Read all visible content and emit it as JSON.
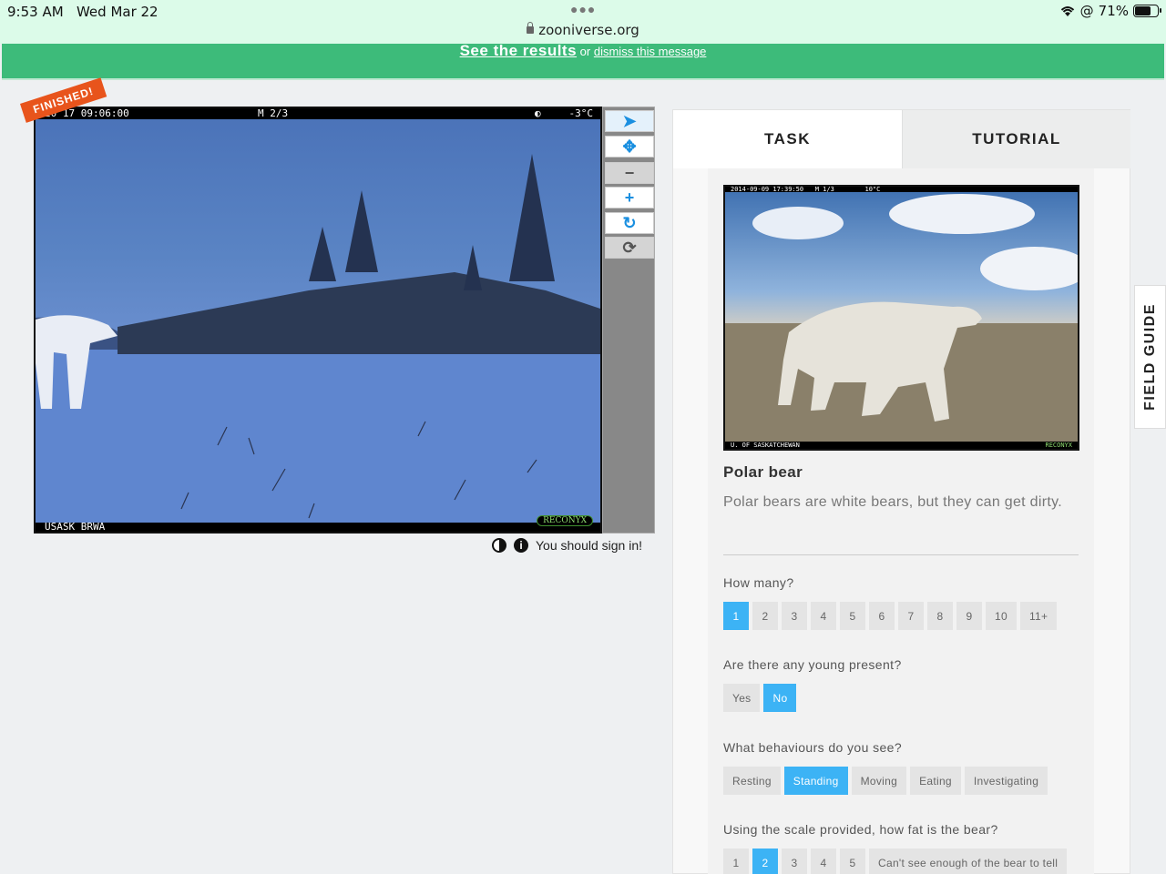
{
  "status": {
    "time": "9:53 AM",
    "date": "Wed Mar 22",
    "battery": "71%",
    "battery_level": 0.71,
    "url": "zooniverse.org"
  },
  "banner": {
    "results_link": "See the results",
    "or_text": "or",
    "dismiss_link": "dismiss this message"
  },
  "subject": {
    "finished_badge": "FINISHED!",
    "cam_top_left": "20  17 09:06:00",
    "cam_top_mid": "M 2/3",
    "cam_top_right": "-3°C",
    "cam_bottom_left": "USASK BRWA",
    "cam_brand": "RECONYX"
  },
  "toolbar": {
    "icons": [
      "pointer-icon",
      "move-icon",
      "zoom-out-icon",
      "zoom-in-icon",
      "rotate-icon",
      "reset-icon"
    ]
  },
  "viewer_footer": {
    "sign_in_text": "You should sign in!"
  },
  "tabs": {
    "task": "TASK",
    "tutorial": "TUTORIAL"
  },
  "guide": {
    "ref_top_text": "2014-09-09 17:39:50   M 1/3        10°C",
    "ref_bottom_text": "U. OF SASKATCHEWAN",
    "ref_brand": "RECONYX",
    "animal_name": "Polar bear",
    "animal_description": "Polar bears are white bears, but they can get dirty."
  },
  "questions": {
    "how_many": {
      "label": "How many?",
      "options": [
        "1",
        "2",
        "3",
        "4",
        "5",
        "6",
        "7",
        "8",
        "9",
        "10",
        "11+"
      ],
      "selected": "1"
    },
    "young": {
      "label": "Are there any young present?",
      "options": [
        "Yes",
        "No"
      ],
      "selected": "No"
    },
    "behaviours": {
      "label": "What behaviours do you see?",
      "options": [
        "Resting",
        "Standing",
        "Moving",
        "Eating",
        "Investigating"
      ],
      "selected": "Standing"
    },
    "fat": {
      "label": "Using the scale provided, how fat is the bear?",
      "options": [
        "1",
        "2",
        "3",
        "4",
        "5",
        "Can't see enough of the bear to tell"
      ],
      "selected": "2"
    }
  },
  "field_guide": "FIELD GUIDE"
}
